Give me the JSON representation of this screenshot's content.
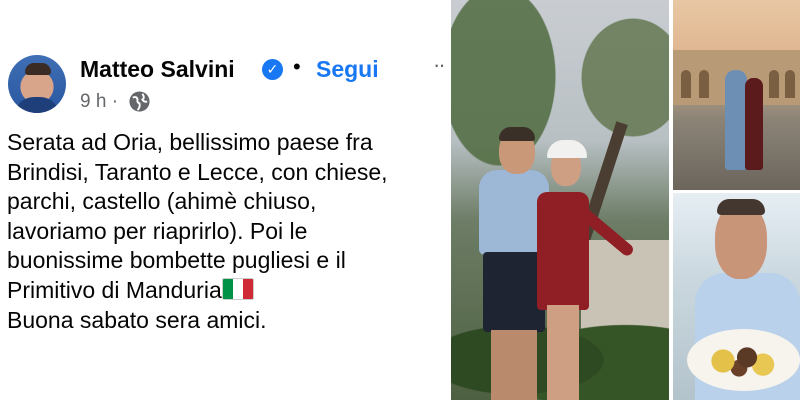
{
  "post": {
    "author": "Matteo Salvini",
    "separator": "•",
    "follow_label": "Segui",
    "more_label": "··",
    "timestamp": "9 h ·",
    "text_lines": [
      "Serata ad Oria, bellissimo paese fra",
      "Brindisi, Taranto e Lecce, con chiese,",
      "parchi, castello (ahimè chiuso,",
      "lavoriamo per riaprirlo). Poi le",
      "buonissime bombette pugliesi e il",
      "Primitivo di Manduria",
      "Buona sabato sera amici."
    ]
  },
  "icons": {
    "verified": "verified-badge-icon",
    "visibility": "globe-icon",
    "flag": "italy-flag-icon"
  },
  "colors": {
    "accent": "#1877f2",
    "text": "#050505",
    "muted": "#65676b"
  }
}
